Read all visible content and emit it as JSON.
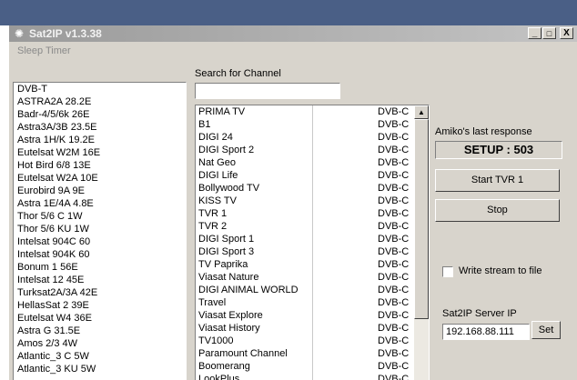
{
  "window": {
    "title": "Sat2IP v1.3.38",
    "min": "_",
    "max": "□",
    "close": "X"
  },
  "menu": {
    "sleep_timer": "Sleep Timer"
  },
  "satellites": [
    "DVB-T",
    "ASTRA2A 28.2E",
    "Badr-4/5/6k 26E",
    "Astra3A/3B 23.5E",
    "Astra 1H/K 19.2E",
    "Eutelsat W2M 16E",
    "Hot Bird 6/8 13E",
    "Eutelsat W2A 10E",
    "Eurobird 9A 9E",
    "Astra 1E/4A 4.8E",
    "Thor 5/6 C 1W",
    "Thor 5/6 KU 1W",
    "Intelsat 904C 60",
    "Intelsat 904K 60",
    "Bonum 1 56E",
    "Intelsat 12 45E",
    "Turksat2A/3A 42E",
    "HellasSat 2 39E",
    "Eutelsat W4 36E",
    "Astra G 31.5E",
    "Amos 2/3 4W",
    "Atlantic_3 C 5W",
    "Atlantic_3 KU 5W"
  ],
  "search": {
    "label": "Search for Channel",
    "value": ""
  },
  "channels": [
    {
      "name": "PRIMA TV",
      "type": "DVB-C"
    },
    {
      "name": "B1",
      "type": "DVB-C"
    },
    {
      "name": "DIGI 24",
      "type": "DVB-C"
    },
    {
      "name": "DIGI Sport 2",
      "type": "DVB-C"
    },
    {
      "name": "Nat Geo",
      "type": "DVB-C"
    },
    {
      "name": "DIGI Life",
      "type": "DVB-C"
    },
    {
      "name": "Bollywood TV",
      "type": "DVB-C"
    },
    {
      "name": "KISS TV",
      "type": "DVB-C"
    },
    {
      "name": "TVR 1",
      "type": "DVB-C"
    },
    {
      "name": "TVR 2",
      "type": "DVB-C"
    },
    {
      "name": "DIGI Sport 1",
      "type": "DVB-C"
    },
    {
      "name": "DIGI Sport 3",
      "type": "DVB-C"
    },
    {
      "name": "TV Paprika",
      "type": "DVB-C"
    },
    {
      "name": "Viasat Nature",
      "type": "DVB-C"
    },
    {
      "name": "DIGI ANIMAL WORLD",
      "type": "DVB-C"
    },
    {
      "name": "Travel",
      "type": "DVB-C"
    },
    {
      "name": "Viasat Explore",
      "type": "DVB-C"
    },
    {
      "name": "Viasat History",
      "type": "DVB-C"
    },
    {
      "name": "TV1000",
      "type": "DVB-C"
    },
    {
      "name": "Paramount Channel",
      "type": "DVB-C"
    },
    {
      "name": "Boomerang",
      "type": "DVB-C"
    },
    {
      "name": "LookPlus",
      "type": "DVB-C"
    }
  ],
  "response": {
    "label": "Amiko's last response",
    "value": "SETUP : 503"
  },
  "buttons": {
    "start": "Start TVR 1",
    "stop": "Stop",
    "set": "Set"
  },
  "stream": {
    "label": "Write stream to file",
    "checked": false
  },
  "server": {
    "label": "Sat2IP Server IP",
    "ip": "192.168.88.111"
  }
}
